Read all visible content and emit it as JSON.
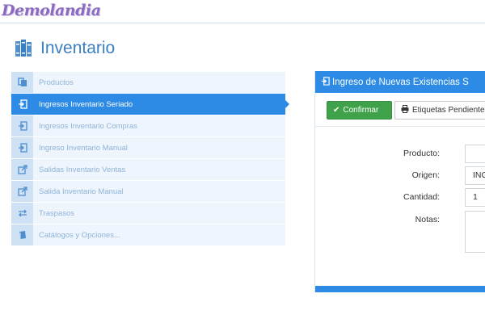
{
  "app": {
    "logo_text": "Demolandia"
  },
  "page": {
    "title": "Inventario",
    "title_icon": "books-icon"
  },
  "menu": {
    "items": [
      {
        "label": "Productos",
        "icon": "copy-icon",
        "active": false
      },
      {
        "label": "Ingresos Inventario Seriado",
        "icon": "sign-in-icon",
        "active": true
      },
      {
        "label": "Ingresos Inventario Compras",
        "icon": "sign-in-icon",
        "active": false
      },
      {
        "label": "Ingreso Inventario Manual",
        "icon": "sign-in-icon",
        "active": false
      },
      {
        "label": "Salidas Inventario Ventas",
        "icon": "external-link-icon",
        "active": false
      },
      {
        "label": "Salida Inventario Manual",
        "icon": "external-link-icon",
        "active": false
      },
      {
        "label": "Traspasos",
        "icon": "exchange-icon",
        "active": false
      },
      {
        "label": "Catálogos y Opciones...",
        "icon": "book-icon",
        "active": false
      }
    ]
  },
  "panel": {
    "header_title": "Ingreso de Nuevas Existencias S",
    "header_icon": "sign-in-icon",
    "confirm_label": "Confirmar",
    "confirm_icon": "check-icon",
    "labels_button": "Etiquetas Pendiente",
    "labels_icon": "print-icon",
    "fields": {
      "producto_label": "Producto:",
      "producto_value": "",
      "origen_label": "Origen:",
      "origen_value": "ING",
      "cantidad_label": "Cantidad:",
      "cantidad_value": "1",
      "notas_label": "Notas:",
      "notas_value": ""
    }
  },
  "colors": {
    "accent": "#2d8be6",
    "confirm": "#3fa24a",
    "title": "#3a7fc2",
    "logo": "#8b6bbd"
  }
}
